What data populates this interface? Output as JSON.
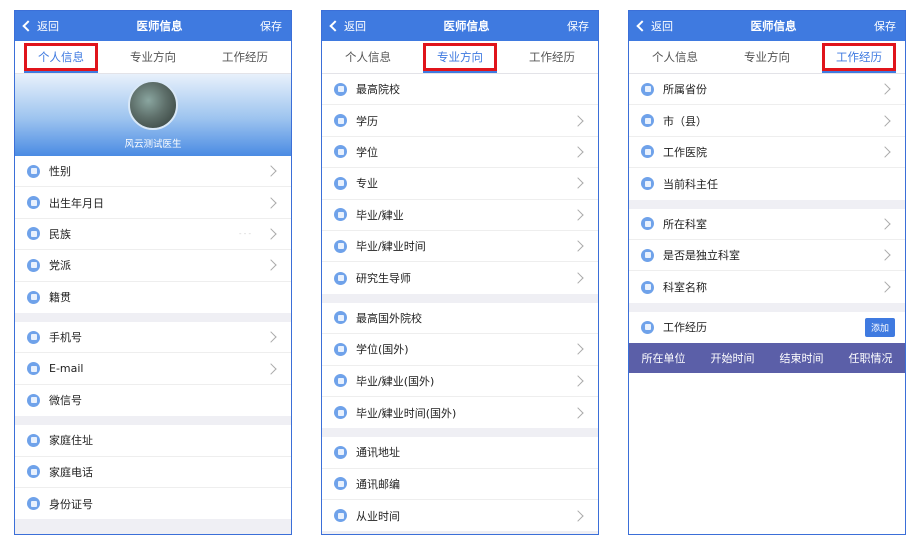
{
  "nav": {
    "back": "返回",
    "title": "医师信息",
    "save": "保存"
  },
  "tabs": [
    "个人信息",
    "专业方向",
    "工作经历"
  ],
  "screen1": {
    "doctor_name": "风云测试医生",
    "groups": [
      [
        {
          "label": "性别",
          "arrow": true
        },
        {
          "label": "出生年月日",
          "arrow": true
        },
        {
          "label": "民族",
          "arrow": true,
          "hint": "- - -"
        },
        {
          "label": "党派",
          "arrow": true
        },
        {
          "label": "籍贯",
          "arrow": false
        }
      ],
      [
        {
          "label": "手机号",
          "arrow": true
        },
        {
          "label": "E-mail",
          "arrow": true
        },
        {
          "label": "微信号",
          "arrow": false
        }
      ],
      [
        {
          "label": "家庭住址",
          "arrow": false
        },
        {
          "label": "家庭电话",
          "arrow": false
        },
        {
          "label": "身份证号",
          "arrow": false
        }
      ]
    ]
  },
  "screen2": {
    "groups": [
      [
        {
          "label": "最高院校",
          "arrow": false
        },
        {
          "label": "学历",
          "arrow": true
        },
        {
          "label": "学位",
          "arrow": true
        },
        {
          "label": "专业",
          "arrow": true
        },
        {
          "label": "毕业/肄业",
          "arrow": true
        },
        {
          "label": "毕业/肄业时间",
          "arrow": true
        },
        {
          "label": "研究生导师",
          "arrow": true
        }
      ],
      [
        {
          "label": "最高国外院校",
          "arrow": false
        },
        {
          "label": "学位(国外)",
          "arrow": true
        },
        {
          "label": "毕业/肄业(国外)",
          "arrow": true
        },
        {
          "label": "毕业/肄业时间(国外)",
          "arrow": true
        }
      ],
      [
        {
          "label": "通讯地址",
          "arrow": false
        },
        {
          "label": "通讯邮编",
          "arrow": false
        },
        {
          "label": "从业时间",
          "arrow": true
        }
      ]
    ]
  },
  "screen3": {
    "groups": [
      [
        {
          "label": "所属省份",
          "arrow": true
        },
        {
          "label": "市（县）",
          "arrow": true
        },
        {
          "label": "工作医院",
          "arrow": true
        },
        {
          "label": "当前科主任",
          "arrow": false
        }
      ],
      [
        {
          "label": "所在科室",
          "arrow": true
        },
        {
          "label": "是否是独立科室",
          "arrow": true
        },
        {
          "label": "科室名称",
          "arrow": true
        }
      ]
    ],
    "work_label": "工作经历",
    "add_button": "添加",
    "table_headers": [
      "所在单位",
      "开始时间",
      "结束时间",
      "任职情况"
    ]
  },
  "colors": {
    "primary": "#3f7ae0",
    "highlight": "#e0141b",
    "table_header": "#5b5fa8"
  }
}
